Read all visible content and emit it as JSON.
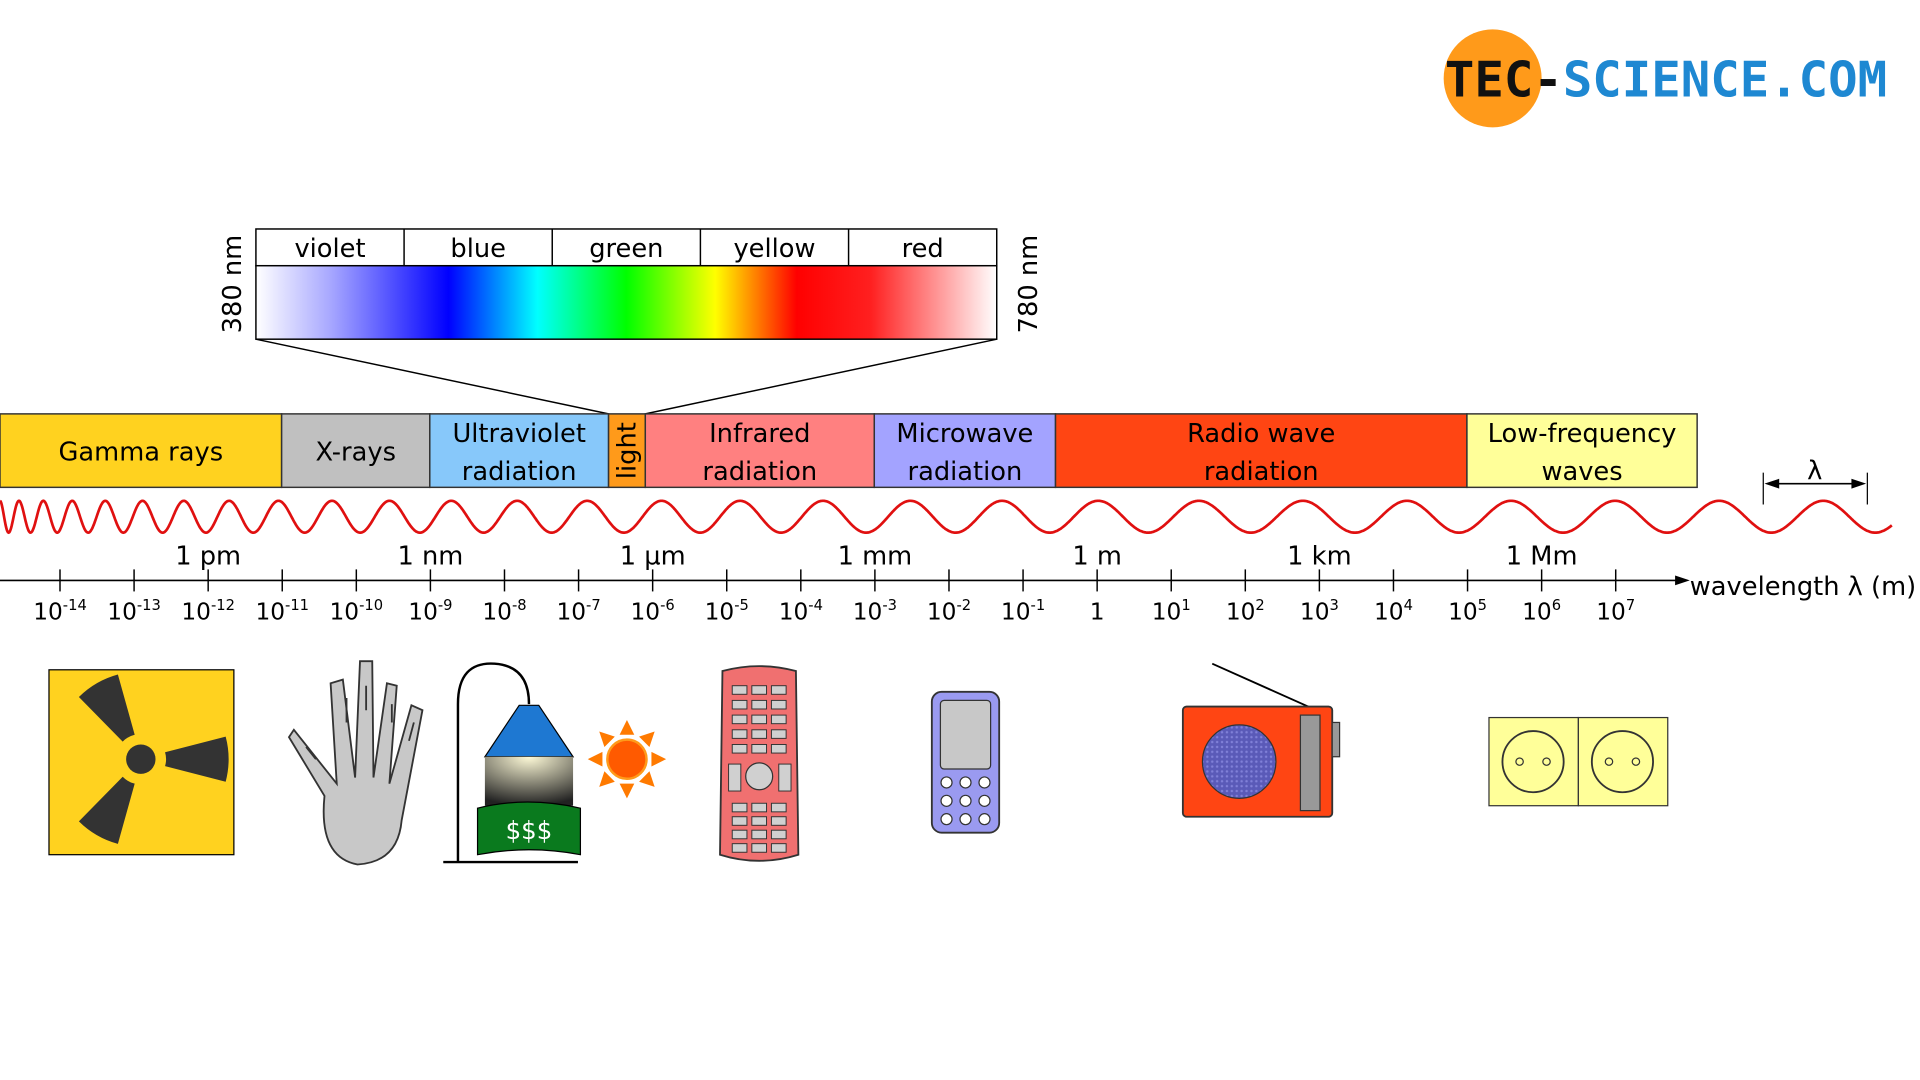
{
  "logo": {
    "text_dark": "TEC-",
    "text_mid": "SCIENCE",
    "text_blue": ".COM",
    "colors": {
      "circle": "#FF9A1A",
      "blue": "#1E88D2",
      "dark": "#111111"
    }
  },
  "visible_spectrum": {
    "colors": [
      "violet",
      "blue",
      "green",
      "yellow",
      "red"
    ],
    "start_label": "380 nm",
    "end_label": "780 nm"
  },
  "bands": [
    {
      "lines": [
        "Gamma rays"
      ],
      "color": "#FFD21F"
    },
    {
      "lines": [
        "X-rays"
      ],
      "color": "#C0C0C0"
    },
    {
      "lines": [
        "Ultraviolet",
        "radiation"
      ],
      "color": "#87C8FA"
    },
    {
      "lines": [
        "light"
      ],
      "color": "#FF9A1A",
      "vertical": true
    },
    {
      "lines": [
        "Infrared",
        "radiation"
      ],
      "color": "#FF8080"
    },
    {
      "lines": [
        "Microwave",
        "radiation"
      ],
      "color": "#A3A3FF"
    },
    {
      "lines": [
        "Radio wave",
        "radiation"
      ],
      "color": "#FF4513"
    },
    {
      "lines": [
        "Low-frequency",
        "waves"
      ],
      "color": "#FFFF99"
    }
  ],
  "wave": {
    "color": "#E01010",
    "lambda_label": "λ"
  },
  "axis": {
    "label": "wavelength λ (m)",
    "exponents": [
      "-14",
      "-13",
      "-12",
      "-11",
      "-10",
      "-9",
      "-8",
      "-7",
      "-6",
      "-5",
      "-4",
      "-3",
      "-2",
      "-1",
      "0",
      "1",
      "2",
      "3",
      "4",
      "5",
      "6",
      "7"
    ],
    "units": [
      {
        "text": "1 pm",
        "exponent": -12
      },
      {
        "text": "1 nm",
        "exponent": -9
      },
      {
        "text": "1 µm",
        "exponent": -6
      },
      {
        "text": "1 mm",
        "exponent": -3
      },
      {
        "text": "1 m",
        "exponent": 0
      },
      {
        "text": "1 km",
        "exponent": 3
      },
      {
        "text": "1 Mm",
        "exponent": 6
      }
    ]
  },
  "icons": [
    "radiation-icon",
    "hand-xray-icon",
    "tanning-lamp-icon",
    "sun-icon",
    "remote-control-icon",
    "mobile-phone-icon",
    "radio-icon",
    "power-socket-icon"
  ],
  "lamp_banner": "$$$"
}
